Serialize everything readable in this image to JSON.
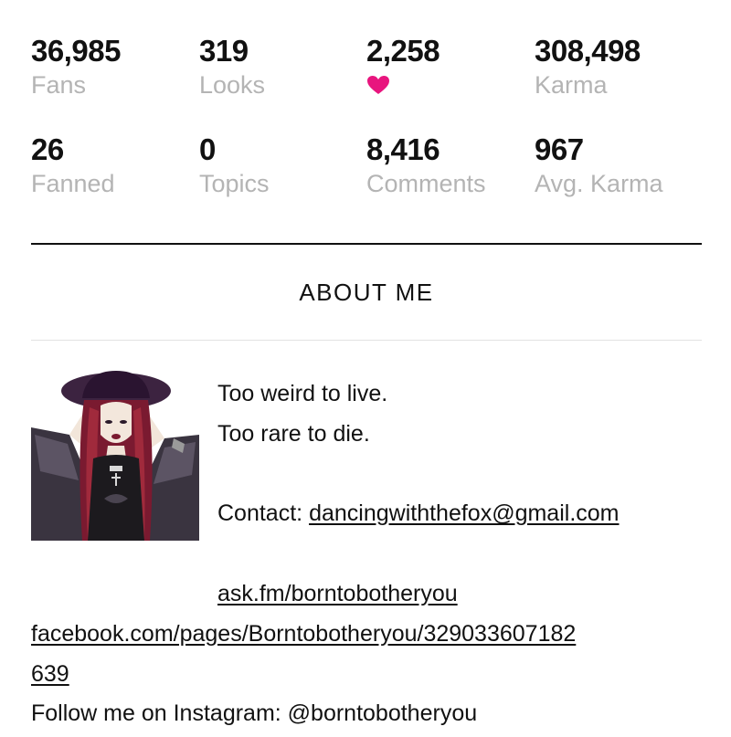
{
  "stats": [
    {
      "value": "36,985",
      "label": "Fans"
    },
    {
      "value": "319",
      "label": "Looks"
    },
    {
      "value": "2,258",
      "label": "",
      "icon": "heart-icon",
      "icon_color": "#e8157e"
    },
    {
      "value": "308,498",
      "label": "Karma"
    },
    {
      "value": "26",
      "label": "Fanned"
    },
    {
      "value": "0",
      "label": "Topics"
    },
    {
      "value": "8,416",
      "label": "Comments"
    },
    {
      "value": "967",
      "label": "Avg. Karma"
    }
  ],
  "about": {
    "title": "ABOUT ME",
    "line1": "Too weird to live.",
    "line2": "Too rare to die.",
    "contact_prefix": "Contact: ",
    "contact_email": "dancingwiththefox@gmail.com",
    "askfm": "ask.fm/borntobotheryou",
    "facebook_part1": "facebook.com/pages/Borntobotheryou/329033607182",
    "facebook_part2": "639",
    "instagram": "Follow me on Instagram: @borntobotheryou"
  },
  "colors": {
    "label_gray": "#b4b4b4",
    "heart": "#e8157e",
    "rule_dark": "#111111",
    "rule_light": "#e2e2e2"
  }
}
